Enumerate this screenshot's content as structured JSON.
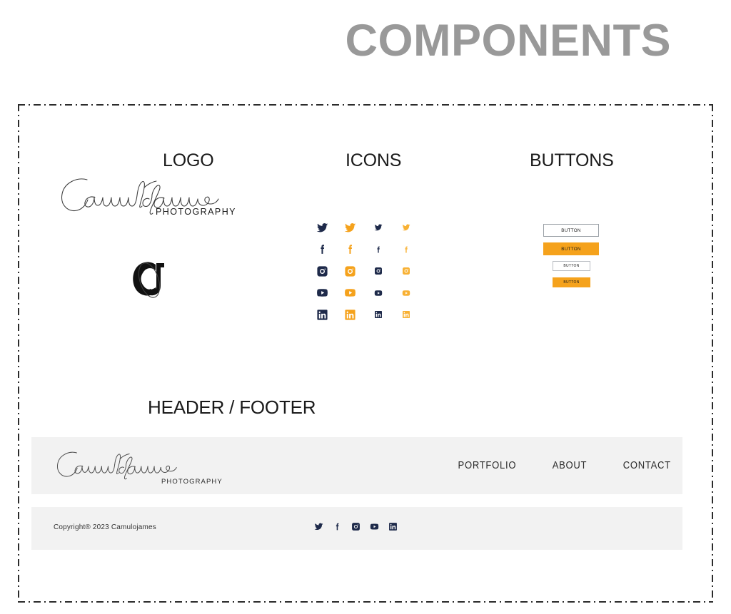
{
  "page": {
    "title": "COMPONENTS",
    "title_color": "#999999",
    "background": "#ffffff"
  },
  "frame": {
    "border_style": "dash-dot",
    "border_color": "#2b2b2b"
  },
  "sections": {
    "logo": {
      "label": "LOGO"
    },
    "icons": {
      "label": "ICONS"
    },
    "buttons": {
      "label": "BUTTONS"
    },
    "header_footer": {
      "label": "HEADER / FOOTER"
    }
  },
  "brand": {
    "wordmark": "Camulojames",
    "tagline": "PHOTOGRAPHY",
    "monogram": "CJ",
    "wordmark_color": "#3a3a3a",
    "tagline_color": "#1a1a1a"
  },
  "colors": {
    "accent_orange": "#f5a21c",
    "accent_orange_light": "#f8b134",
    "dark_navy": "#1e2a4a",
    "bar_gray": "#f2f2f2",
    "outline_gray": "#9aa0a6"
  },
  "icons": {
    "rows": [
      {
        "name": "twitter",
        "icon_name": "twitter-icon",
        "cells": [
          {
            "color": "#1e2a4a",
            "size": 17
          },
          {
            "color": "#f5a21c",
            "size": 17
          },
          {
            "color": "#1e2a4a",
            "size": 12
          },
          {
            "color": "#f8b134",
            "size": 12
          }
        ]
      },
      {
        "name": "facebook",
        "icon_name": "facebook-icon",
        "cells": [
          {
            "color": "#1e2a4a",
            "size": 17
          },
          {
            "color": "#f5a21c",
            "size": 17
          },
          {
            "color": "#1e2a4a",
            "size": 12
          },
          {
            "color": "#f8b134",
            "size": 12
          }
        ]
      },
      {
        "name": "instagram",
        "icon_name": "instagram-icon",
        "cells": [
          {
            "color": "#1e2a4a",
            "size": 17
          },
          {
            "color": "#f5a21c",
            "size": 17
          },
          {
            "color": "#1e2a4a",
            "size": 12
          },
          {
            "color": "#f8b134",
            "size": 12
          }
        ]
      },
      {
        "name": "youtube",
        "icon_name": "youtube-icon",
        "cells": [
          {
            "color": "#1e2a4a",
            "size": 17
          },
          {
            "color": "#f5a21c",
            "size": 17
          },
          {
            "color": "#1e2a4a",
            "size": 12
          },
          {
            "color": "#f8b134",
            "size": 12
          }
        ]
      },
      {
        "name": "linkedin",
        "icon_name": "linkedin-icon",
        "cells": [
          {
            "color": "#1e2a4a",
            "size": 17
          },
          {
            "color": "#f5a21c",
            "size": 17
          },
          {
            "color": "#1e2a4a",
            "size": 12
          },
          {
            "color": "#f8b134",
            "size": 12
          }
        ]
      }
    ]
  },
  "buttons": [
    {
      "label": "BUTTON",
      "variant": "outline",
      "size": "large"
    },
    {
      "label": "BUTTON",
      "variant": "solid",
      "size": "large"
    },
    {
      "label": "BUTTON",
      "variant": "outline",
      "size": "small"
    },
    {
      "label": "BUTTON",
      "variant": "solid",
      "size": "small"
    }
  ],
  "header": {
    "logo_wordmark": "Camulojames",
    "logo_tagline": "PHOTOGRAPHY",
    "nav": [
      {
        "label": "PORTFOLIO"
      },
      {
        "label": "ABOUT"
      },
      {
        "label": "CONTACT"
      }
    ]
  },
  "footer": {
    "copyright": "Copyright® 2023 Camulojames",
    "socials": [
      {
        "name": "twitter",
        "icon_name": "twitter-icon",
        "color": "#1e2a4a"
      },
      {
        "name": "facebook",
        "icon_name": "facebook-icon",
        "color": "#1e2a4a"
      },
      {
        "name": "instagram",
        "icon_name": "instagram-icon",
        "color": "#1e2a4a"
      },
      {
        "name": "youtube",
        "icon_name": "youtube-icon",
        "color": "#1e2a4a"
      },
      {
        "name": "linkedin",
        "icon_name": "linkedin-icon",
        "color": "#1e2a4a"
      }
    ]
  }
}
